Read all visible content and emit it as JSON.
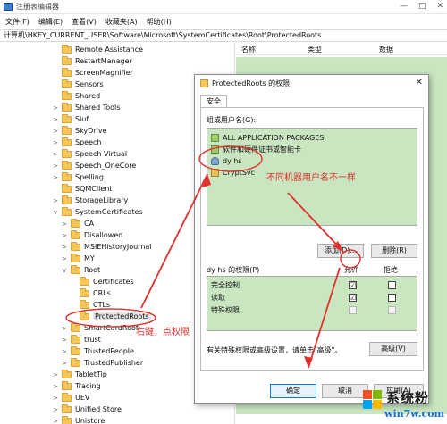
{
  "window": {
    "title": "注册表编辑器",
    "controls": [
      "—",
      "□",
      "✕"
    ]
  },
  "menu": [
    "文件(F)",
    "编辑(E)",
    "查看(V)",
    "收藏夹(A)",
    "帮助(H)"
  ],
  "address": "计算机\\HKEY_CURRENT_USER\\Software\\Microsoft\\SystemCertificates\\Root\\ProtectedRoots",
  "list_headers": {
    "name": "名称",
    "type": "类型",
    "data": "数据"
  },
  "tree": [
    {
      "label": "Remote Assistance",
      "expander": ""
    },
    {
      "label": "RestartManager",
      "expander": ""
    },
    {
      "label": "ScreenMagnifier",
      "expander": ""
    },
    {
      "label": "Sensors",
      "expander": ""
    },
    {
      "label": "Shared",
      "expander": ""
    },
    {
      "label": "Shared Tools",
      "expander": ">"
    },
    {
      "label": "Siuf",
      "expander": ">"
    },
    {
      "label": "SkyDrive",
      "expander": ">"
    },
    {
      "label": "Speech",
      "expander": ">"
    },
    {
      "label": "Speech Virtual",
      "expander": ">"
    },
    {
      "label": "Speech_OneCore",
      "expander": ">"
    },
    {
      "label": "Spelling",
      "expander": ">"
    },
    {
      "label": "SQMClient",
      "expander": ""
    },
    {
      "label": "StorageLibrary",
      "expander": ">"
    },
    {
      "label": "SystemCertificates",
      "expander": "v"
    },
    {
      "label": "CA",
      "expander": ">"
    },
    {
      "label": "Disallowed",
      "expander": ">"
    },
    {
      "label": "MSIEHistoryJournal",
      "expander": ">"
    },
    {
      "label": "MY",
      "expander": ">"
    },
    {
      "label": "Root",
      "expander": "v"
    },
    {
      "label": "Certificates",
      "expander": ""
    },
    {
      "label": "CRLs",
      "expander": ""
    },
    {
      "label": "CTLs",
      "expander": ""
    },
    {
      "label": "ProtectedRoots",
      "expander": ""
    },
    {
      "label": "SmartCardRoot",
      "expander": ">"
    },
    {
      "label": "trust",
      "expander": ">"
    },
    {
      "label": "TrustedPeople",
      "expander": ">"
    },
    {
      "label": "TrustedPublisher",
      "expander": ">"
    },
    {
      "label": "TabletTip",
      "expander": ">"
    },
    {
      "label": "Tracing",
      "expander": ">"
    },
    {
      "label": "UEV",
      "expander": ">"
    },
    {
      "label": "Unified Store",
      "expander": ">"
    },
    {
      "label": "Unistore",
      "expander": ">"
    }
  ],
  "dialog": {
    "title": "ProtectedRoots 的权限",
    "close": "✕",
    "tab": "安全",
    "group_label": "组或用户名(G):",
    "users": [
      "ALL APPLICATION PACKAGES",
      "软件和硬件证书或智能卡",
      "dy hs",
      "CryptSvc"
    ],
    "add_button": "添加(D)...",
    "remove_button": "删除(R)",
    "perm_label": "dy hs 的权限(P)",
    "allow_header": "允许",
    "deny_header": "拒绝",
    "permissions": [
      {
        "name": "完全控制",
        "allow": "☑",
        "deny": ""
      },
      {
        "name": "读取",
        "allow": "☑",
        "deny": ""
      },
      {
        "name": "特殊权限",
        "allow": "",
        "deny": ""
      }
    ],
    "advanced_note": "有关特殊权限或高级设置，请单击\"高级\"。",
    "advanced_button": "高级(V)",
    "ok_button": "确定",
    "cancel_button": "取消",
    "apply_button": "应用(A)"
  },
  "annotations": {
    "user_note": "不同机器用户名不一样",
    "rightclick_note": "右键，点权限"
  },
  "watermark": {
    "brand": "系统粉",
    "url": "win7w.com"
  },
  "colors": {
    "annotation_red": "#e0302b",
    "list_green": "#c9e6c1",
    "folder_yellow": "#f4c75a"
  }
}
